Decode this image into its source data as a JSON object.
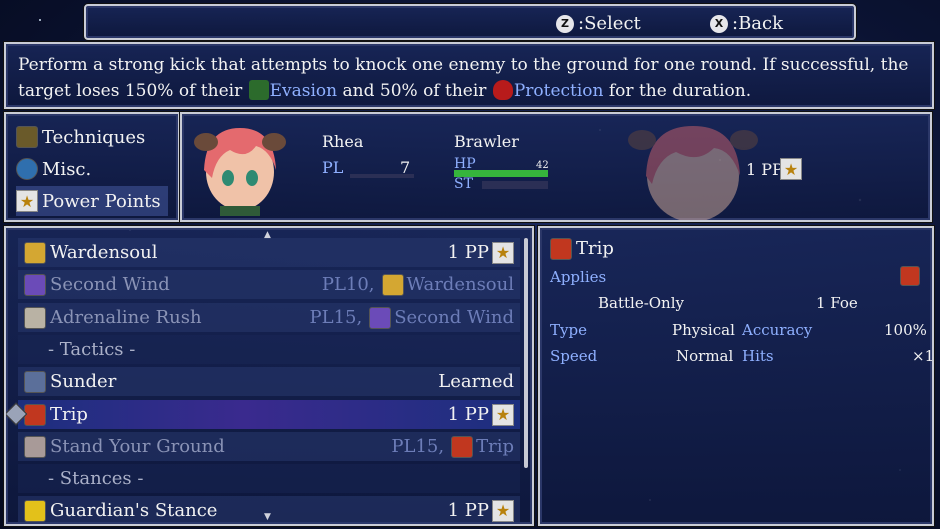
{
  "prompts": {
    "select_glyph": "Z",
    "select_label": ":Select",
    "back_glyph": "X",
    "back_label": ":Back"
  },
  "description": {
    "part1": "Perform a strong kick that attempts to knock one enemy to the ground for one round. If successful, the target loses 150% of their ",
    "kw1": "Evasion",
    "part2": " and 50% of their ",
    "kw2": "Protection",
    "part3": " for the duration."
  },
  "categories": [
    {
      "label": "Techniques",
      "icon": "techniques-icon",
      "selected": false
    },
    {
      "label": "Misc.",
      "icon": "misc-icon",
      "selected": false
    },
    {
      "label": "Power Points",
      "icon": "star-icon",
      "selected": true
    }
  ],
  "character": {
    "name": "Rhea",
    "class": "Brawler",
    "pl_label": "PL",
    "pl_value": "7",
    "hp_label": "HP",
    "hp_value": "42",
    "hp_fraction": 1.0,
    "st_label": "ST",
    "pp_text": "1 PP"
  },
  "skills": [
    {
      "name": "Wardensoul",
      "type": "item",
      "dim": false,
      "selected": false,
      "pp": "1 PP",
      "icon_color": "#d4a732"
    },
    {
      "name": "Second Wind",
      "type": "item",
      "dim": true,
      "selected": false,
      "req_pl": "PL10,",
      "req_skill": "Wardensoul",
      "icon_color": "#6b4bb8",
      "req_icon_color": "#d4a732"
    },
    {
      "name": "Adrenaline Rush",
      "type": "item",
      "dim": true,
      "selected": false,
      "req_pl": "PL15,",
      "req_skill": "Second Wind",
      "icon_color": "#b9b2a4",
      "req_icon_color": "#6b4bb8"
    },
    {
      "name": "- Tactics -",
      "type": "header"
    },
    {
      "name": "Sunder",
      "type": "item",
      "dim": false,
      "selected": false,
      "status": "Learned",
      "icon_color": "#5b6f9a"
    },
    {
      "name": "Trip",
      "type": "item",
      "dim": false,
      "selected": true,
      "pp": "1 PP",
      "icon_color": "#c1371f"
    },
    {
      "name": "Stand Your Ground",
      "type": "item",
      "dim": true,
      "selected": false,
      "req_pl": "PL15,",
      "req_skill": "Trip",
      "icon_color": "#a89a98",
      "req_icon_color": "#c1371f"
    },
    {
      "name": "- Stances -",
      "type": "header"
    },
    {
      "name": "Guardian's Stance",
      "type": "item",
      "dim": false,
      "selected": false,
      "pp": "1 PP",
      "icon_color": "#e3c11a"
    }
  ],
  "detail": {
    "title": "Trip",
    "applies_label": "Applies",
    "scope": "Battle-Only",
    "target": "1 Foe",
    "type_label": "Type",
    "type_value": "Physical",
    "accuracy_label": "Accuracy",
    "accuracy_value": "100%",
    "speed_label": "Speed",
    "speed_value": "Normal",
    "hits_label": "Hits",
    "hits_value": "×1"
  }
}
